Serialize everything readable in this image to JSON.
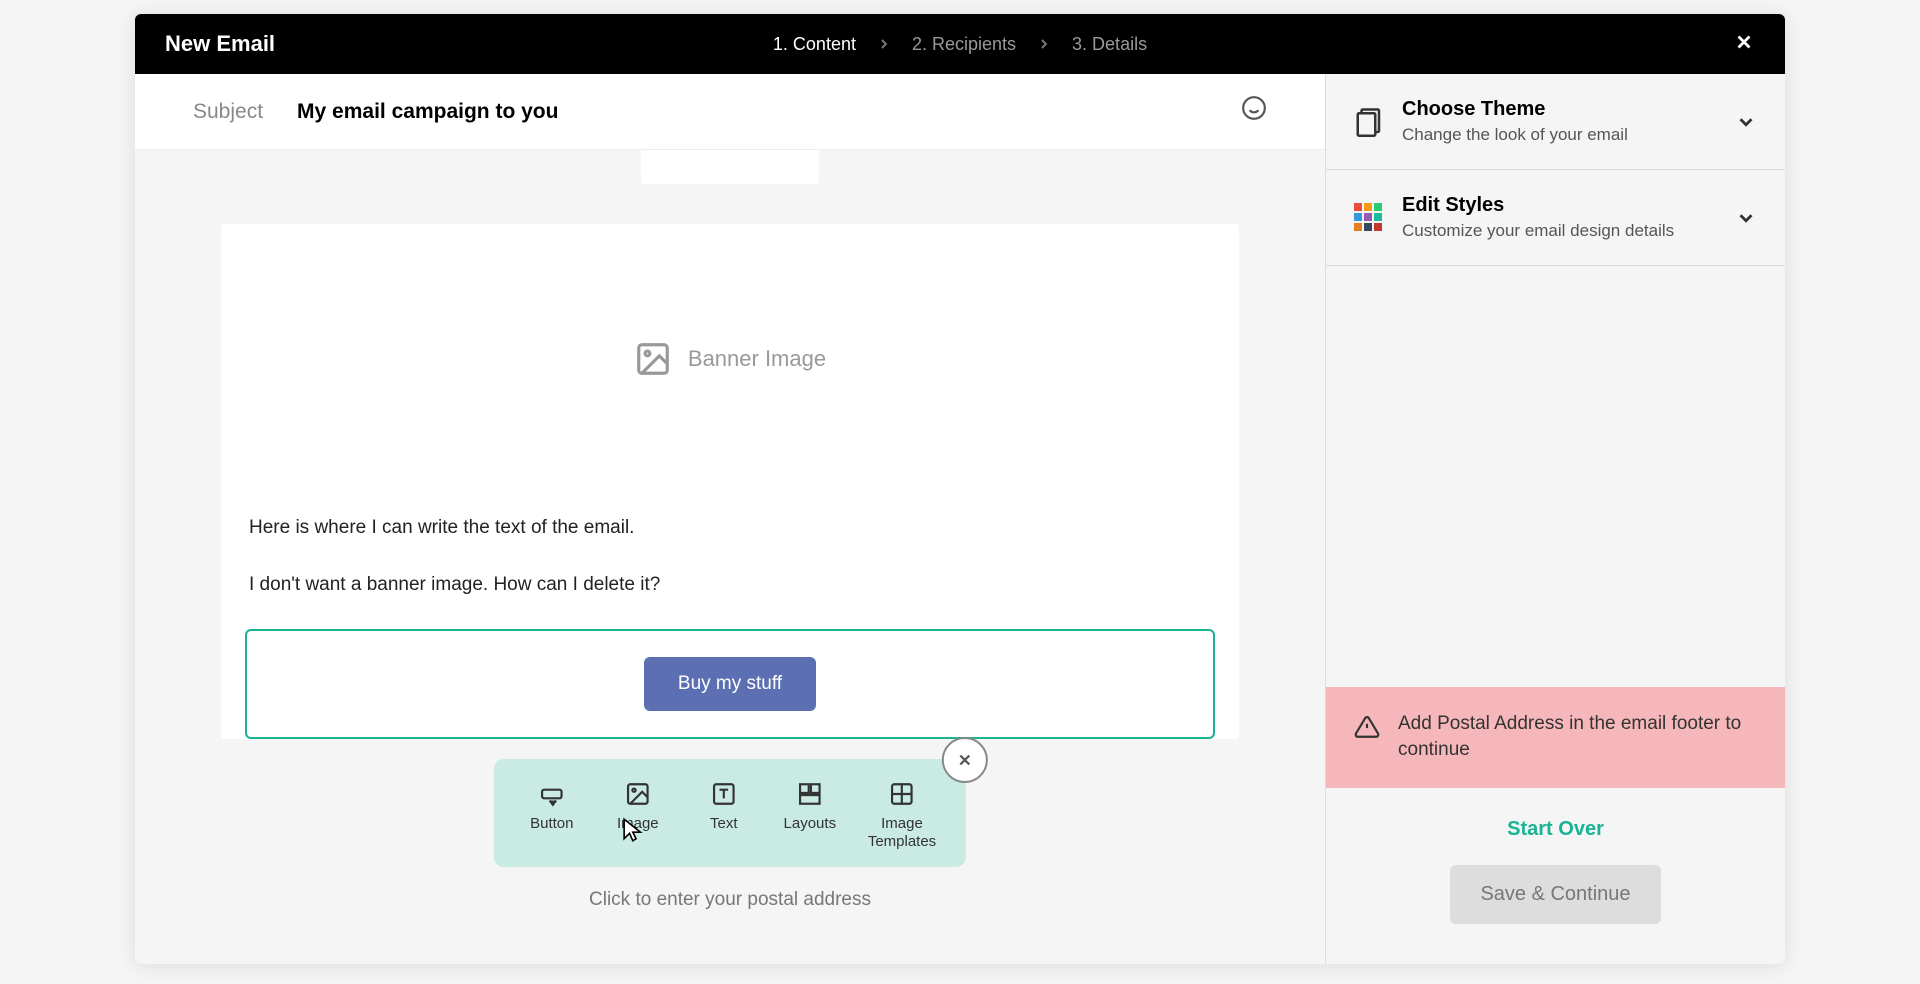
{
  "header": {
    "title": "New Email",
    "steps": [
      "1. Content",
      "2. Recipients",
      "3. Details"
    ],
    "active_step_index": 0
  },
  "subject": {
    "label": "Subject",
    "value": "My email campaign to you"
  },
  "banner": {
    "label": "Banner Image"
  },
  "text_block": {
    "line1": "Here is where I can write the text of the email.",
    "line2": "I don't want a banner image. How can I delete it?"
  },
  "cta": {
    "label": "Buy my stuff"
  },
  "add_menu": {
    "items": [
      {
        "label": "Button",
        "icon": "button"
      },
      {
        "label": "Image",
        "icon": "image"
      },
      {
        "label": "Text",
        "icon": "text"
      },
      {
        "label": "Layouts",
        "icon": "layouts"
      },
      {
        "label": "Image\nTemplates",
        "icon": "templates"
      }
    ]
  },
  "footer_hint": "Click to enter your postal address",
  "sidebar": {
    "choose_theme": {
      "title": "Choose Theme",
      "sub": "Change the look of your email"
    },
    "edit_styles": {
      "title": "Edit Styles",
      "sub": "Customize your email design details"
    },
    "alert": "Add Postal Address in the email footer to continue",
    "start_over": "Start Over",
    "save": "Save & Continue"
  }
}
